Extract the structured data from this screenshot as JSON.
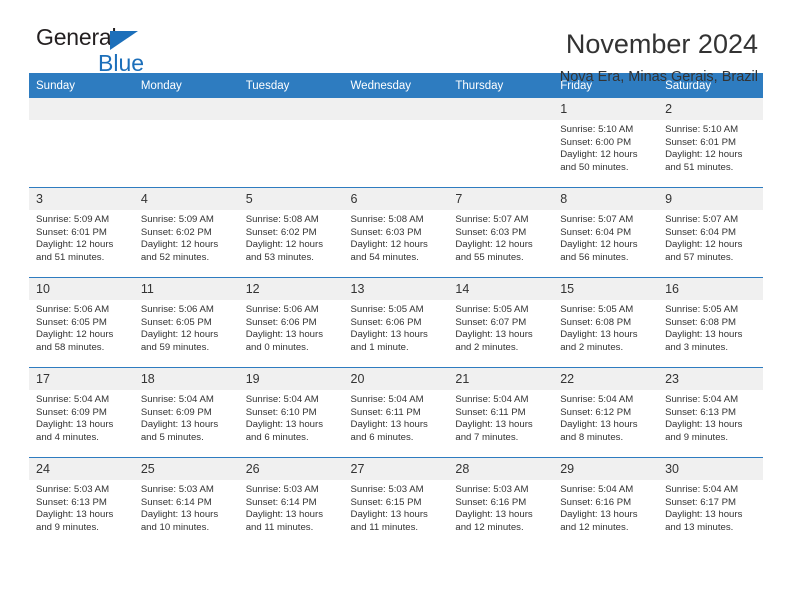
{
  "brand": {
    "name_part1": "General",
    "name_part2": "Blue",
    "triangle_color": "#1c6fba"
  },
  "header": {
    "title": "November 2024",
    "subtitle": "Nova Era, Minas Gerais, Brazil",
    "header_bg": "#2e7cc0",
    "row_divider_color": "#2e7cc0",
    "daynum_bg": "#f0f0f0"
  },
  "weekday_headers": [
    "Sunday",
    "Monday",
    "Tuesday",
    "Wednesday",
    "Thursday",
    "Friday",
    "Saturday"
  ],
  "weeks": [
    [
      {
        "date": "",
        "sunrise": "",
        "sunset": "",
        "daylight": "",
        "empty": true
      },
      {
        "date": "",
        "sunrise": "",
        "sunset": "",
        "daylight": "",
        "empty": true
      },
      {
        "date": "",
        "sunrise": "",
        "sunset": "",
        "daylight": "",
        "empty": true
      },
      {
        "date": "",
        "sunrise": "",
        "sunset": "",
        "daylight": "",
        "empty": true
      },
      {
        "date": "",
        "sunrise": "",
        "sunset": "",
        "daylight": "",
        "empty": true
      },
      {
        "date": "1",
        "sunrise": "Sunrise: 5:10 AM",
        "sunset": "Sunset: 6:00 PM",
        "daylight": "Daylight: 12 hours and 50 minutes.",
        "empty": false
      },
      {
        "date": "2",
        "sunrise": "Sunrise: 5:10 AM",
        "sunset": "Sunset: 6:01 PM",
        "daylight": "Daylight: 12 hours and 51 minutes.",
        "empty": false
      }
    ],
    [
      {
        "date": "3",
        "sunrise": "Sunrise: 5:09 AM",
        "sunset": "Sunset: 6:01 PM",
        "daylight": "Daylight: 12 hours and 51 minutes.",
        "empty": false
      },
      {
        "date": "4",
        "sunrise": "Sunrise: 5:09 AM",
        "sunset": "Sunset: 6:02 PM",
        "daylight": "Daylight: 12 hours and 52 minutes.",
        "empty": false
      },
      {
        "date": "5",
        "sunrise": "Sunrise: 5:08 AM",
        "sunset": "Sunset: 6:02 PM",
        "daylight": "Daylight: 12 hours and 53 minutes.",
        "empty": false
      },
      {
        "date": "6",
        "sunrise": "Sunrise: 5:08 AM",
        "sunset": "Sunset: 6:03 PM",
        "daylight": "Daylight: 12 hours and 54 minutes.",
        "empty": false
      },
      {
        "date": "7",
        "sunrise": "Sunrise: 5:07 AM",
        "sunset": "Sunset: 6:03 PM",
        "daylight": "Daylight: 12 hours and 55 minutes.",
        "empty": false
      },
      {
        "date": "8",
        "sunrise": "Sunrise: 5:07 AM",
        "sunset": "Sunset: 6:04 PM",
        "daylight": "Daylight: 12 hours and 56 minutes.",
        "empty": false
      },
      {
        "date": "9",
        "sunrise": "Sunrise: 5:07 AM",
        "sunset": "Sunset: 6:04 PM",
        "daylight": "Daylight: 12 hours and 57 minutes.",
        "empty": false
      }
    ],
    [
      {
        "date": "10",
        "sunrise": "Sunrise: 5:06 AM",
        "sunset": "Sunset: 6:05 PM",
        "daylight": "Daylight: 12 hours and 58 minutes.",
        "empty": false
      },
      {
        "date": "11",
        "sunrise": "Sunrise: 5:06 AM",
        "sunset": "Sunset: 6:05 PM",
        "daylight": "Daylight: 12 hours and 59 minutes.",
        "empty": false
      },
      {
        "date": "12",
        "sunrise": "Sunrise: 5:06 AM",
        "sunset": "Sunset: 6:06 PM",
        "daylight": "Daylight: 13 hours and 0 minutes.",
        "empty": false
      },
      {
        "date": "13",
        "sunrise": "Sunrise: 5:05 AM",
        "sunset": "Sunset: 6:06 PM",
        "daylight": "Daylight: 13 hours and 1 minute.",
        "empty": false
      },
      {
        "date": "14",
        "sunrise": "Sunrise: 5:05 AM",
        "sunset": "Sunset: 6:07 PM",
        "daylight": "Daylight: 13 hours and 2 minutes.",
        "empty": false
      },
      {
        "date": "15",
        "sunrise": "Sunrise: 5:05 AM",
        "sunset": "Sunset: 6:08 PM",
        "daylight": "Daylight: 13 hours and 2 minutes.",
        "empty": false
      },
      {
        "date": "16",
        "sunrise": "Sunrise: 5:05 AM",
        "sunset": "Sunset: 6:08 PM",
        "daylight": "Daylight: 13 hours and 3 minutes.",
        "empty": false
      }
    ],
    [
      {
        "date": "17",
        "sunrise": "Sunrise: 5:04 AM",
        "sunset": "Sunset: 6:09 PM",
        "daylight": "Daylight: 13 hours and 4 minutes.",
        "empty": false
      },
      {
        "date": "18",
        "sunrise": "Sunrise: 5:04 AM",
        "sunset": "Sunset: 6:09 PM",
        "daylight": "Daylight: 13 hours and 5 minutes.",
        "empty": false
      },
      {
        "date": "19",
        "sunrise": "Sunrise: 5:04 AM",
        "sunset": "Sunset: 6:10 PM",
        "daylight": "Daylight: 13 hours and 6 minutes.",
        "empty": false
      },
      {
        "date": "20",
        "sunrise": "Sunrise: 5:04 AM",
        "sunset": "Sunset: 6:11 PM",
        "daylight": "Daylight: 13 hours and 6 minutes.",
        "empty": false
      },
      {
        "date": "21",
        "sunrise": "Sunrise: 5:04 AM",
        "sunset": "Sunset: 6:11 PM",
        "daylight": "Daylight: 13 hours and 7 minutes.",
        "empty": false
      },
      {
        "date": "22",
        "sunrise": "Sunrise: 5:04 AM",
        "sunset": "Sunset: 6:12 PM",
        "daylight": "Daylight: 13 hours and 8 minutes.",
        "empty": false
      },
      {
        "date": "23",
        "sunrise": "Sunrise: 5:04 AM",
        "sunset": "Sunset: 6:13 PM",
        "daylight": "Daylight: 13 hours and 9 minutes.",
        "empty": false
      }
    ],
    [
      {
        "date": "24",
        "sunrise": "Sunrise: 5:03 AM",
        "sunset": "Sunset: 6:13 PM",
        "daylight": "Daylight: 13 hours and 9 minutes.",
        "empty": false
      },
      {
        "date": "25",
        "sunrise": "Sunrise: 5:03 AM",
        "sunset": "Sunset: 6:14 PM",
        "daylight": "Daylight: 13 hours and 10 minutes.",
        "empty": false
      },
      {
        "date": "26",
        "sunrise": "Sunrise: 5:03 AM",
        "sunset": "Sunset: 6:14 PM",
        "daylight": "Daylight: 13 hours and 11 minutes.",
        "empty": false
      },
      {
        "date": "27",
        "sunrise": "Sunrise: 5:03 AM",
        "sunset": "Sunset: 6:15 PM",
        "daylight": "Daylight: 13 hours and 11 minutes.",
        "empty": false
      },
      {
        "date": "28",
        "sunrise": "Sunrise: 5:03 AM",
        "sunset": "Sunset: 6:16 PM",
        "daylight": "Daylight: 13 hours and 12 minutes.",
        "empty": false
      },
      {
        "date": "29",
        "sunrise": "Sunrise: 5:04 AM",
        "sunset": "Sunset: 6:16 PM",
        "daylight": "Daylight: 13 hours and 12 minutes.",
        "empty": false
      },
      {
        "date": "30",
        "sunrise": "Sunrise: 5:04 AM",
        "sunset": "Sunset: 6:17 PM",
        "daylight": "Daylight: 13 hours and 13 minutes.",
        "empty": false
      }
    ]
  ]
}
